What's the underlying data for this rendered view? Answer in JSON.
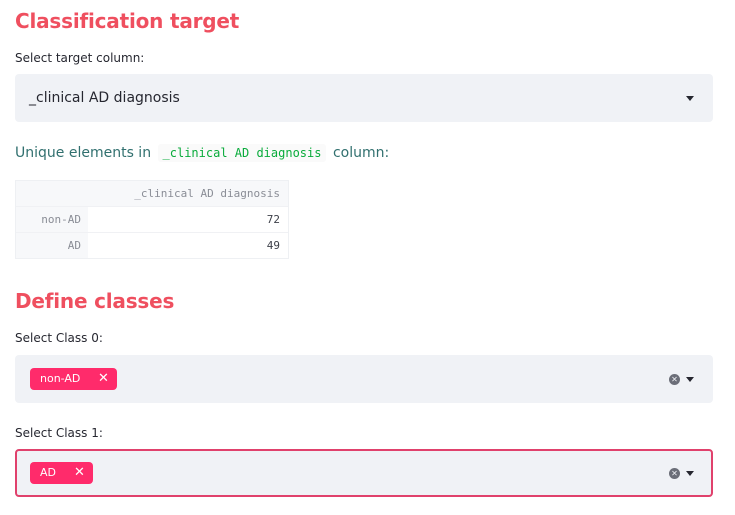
{
  "target_section": {
    "heading": "Classification target",
    "select_label": "Select target column:",
    "selected_value": "_clinical AD diagnosis"
  },
  "unique_text": {
    "prefix": "Unique elements in",
    "column_code": "_clinical AD diagnosis",
    "suffix": "column:"
  },
  "unique_table": {
    "header": "_clinical AD diagnosis",
    "rows": [
      {
        "index": "non-AD",
        "value": "72"
      },
      {
        "index": "AD",
        "value": "49"
      }
    ]
  },
  "classes_section": {
    "heading": "Define classes",
    "class0_label": "Select Class 0:",
    "class0_tags": [
      "non-AD"
    ],
    "class1_label": "Select Class 1:",
    "class1_tags": [
      "AD"
    ]
  },
  "colors": {
    "heading": "#ef4f5f",
    "tag": "#ff2b6b",
    "focus_border": "#e0416c",
    "code_text": "#09ab3b",
    "subtext": "#31706f"
  },
  "icons": {
    "caret": "chevron-down-icon",
    "clear": "clear-circle-icon",
    "tag_remove": "close-icon"
  }
}
